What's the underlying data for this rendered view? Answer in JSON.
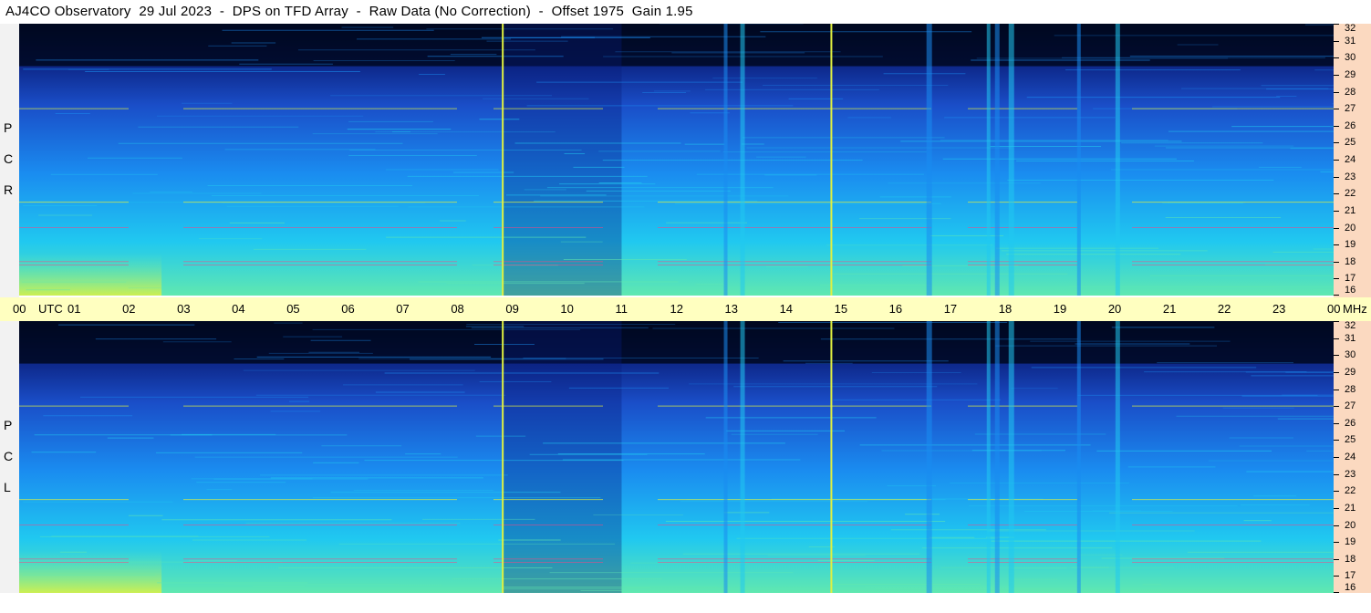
{
  "header": {
    "title": "AJ4CO Observatory  29 Jul 2023  -  DPS on TFD Array  -  Raw Data (No Correction)  -  Offset 1975  Gain 1.95"
  },
  "panels": [
    {
      "label_letters": [
        "P",
        "C",
        "R"
      ]
    },
    {
      "label_letters": [
        "P",
        "C",
        "L"
      ]
    }
  ],
  "chart_data": {
    "type": "heatmap",
    "title": "AJ4CO Observatory  29 Jul 2023  -  DPS on TFD Array  -  Raw Data (No Correction)  -  Offset 1975  Gain 1.95",
    "xlabel": "UTC",
    "ylabel": "MHz",
    "x_ticks": [
      "00",
      "01",
      "02",
      "03",
      "04",
      "05",
      "06",
      "07",
      "08",
      "09",
      "10",
      "11",
      "12",
      "13",
      "14",
      "15",
      "16",
      "17",
      "18",
      "19",
      "20",
      "21",
      "22",
      "23",
      "00"
    ],
    "xlim": [
      0,
      24
    ],
    "y_ticks": [
      "16",
      "17",
      "18",
      "19",
      "20",
      "21",
      "22",
      "23",
      "24",
      "25",
      "26",
      "27",
      "28",
      "29",
      "30",
      "31",
      "32"
    ],
    "ylim": [
      16,
      32
    ],
    "series": [
      {
        "name": "RCP"
      },
      {
        "name": "LCP"
      }
    ],
    "features": {
      "vertical_markers_utc": [
        8.83,
        14.83
      ],
      "bright_columns_utc": [
        12.9,
        13.2,
        16.6,
        17.7,
        17.85,
        18.1,
        19.35,
        20.05
      ],
      "interference_lines_mhz": [
        17.8,
        18.0,
        20.0,
        21.5,
        27.0
      ]
    },
    "colorscale": [
      "#000820",
      "#0a1e7a",
      "#1a4ec8",
      "#1a8cf0",
      "#20c8f0",
      "#60e8b0",
      "#e0f040",
      "#ff4080"
    ]
  }
}
